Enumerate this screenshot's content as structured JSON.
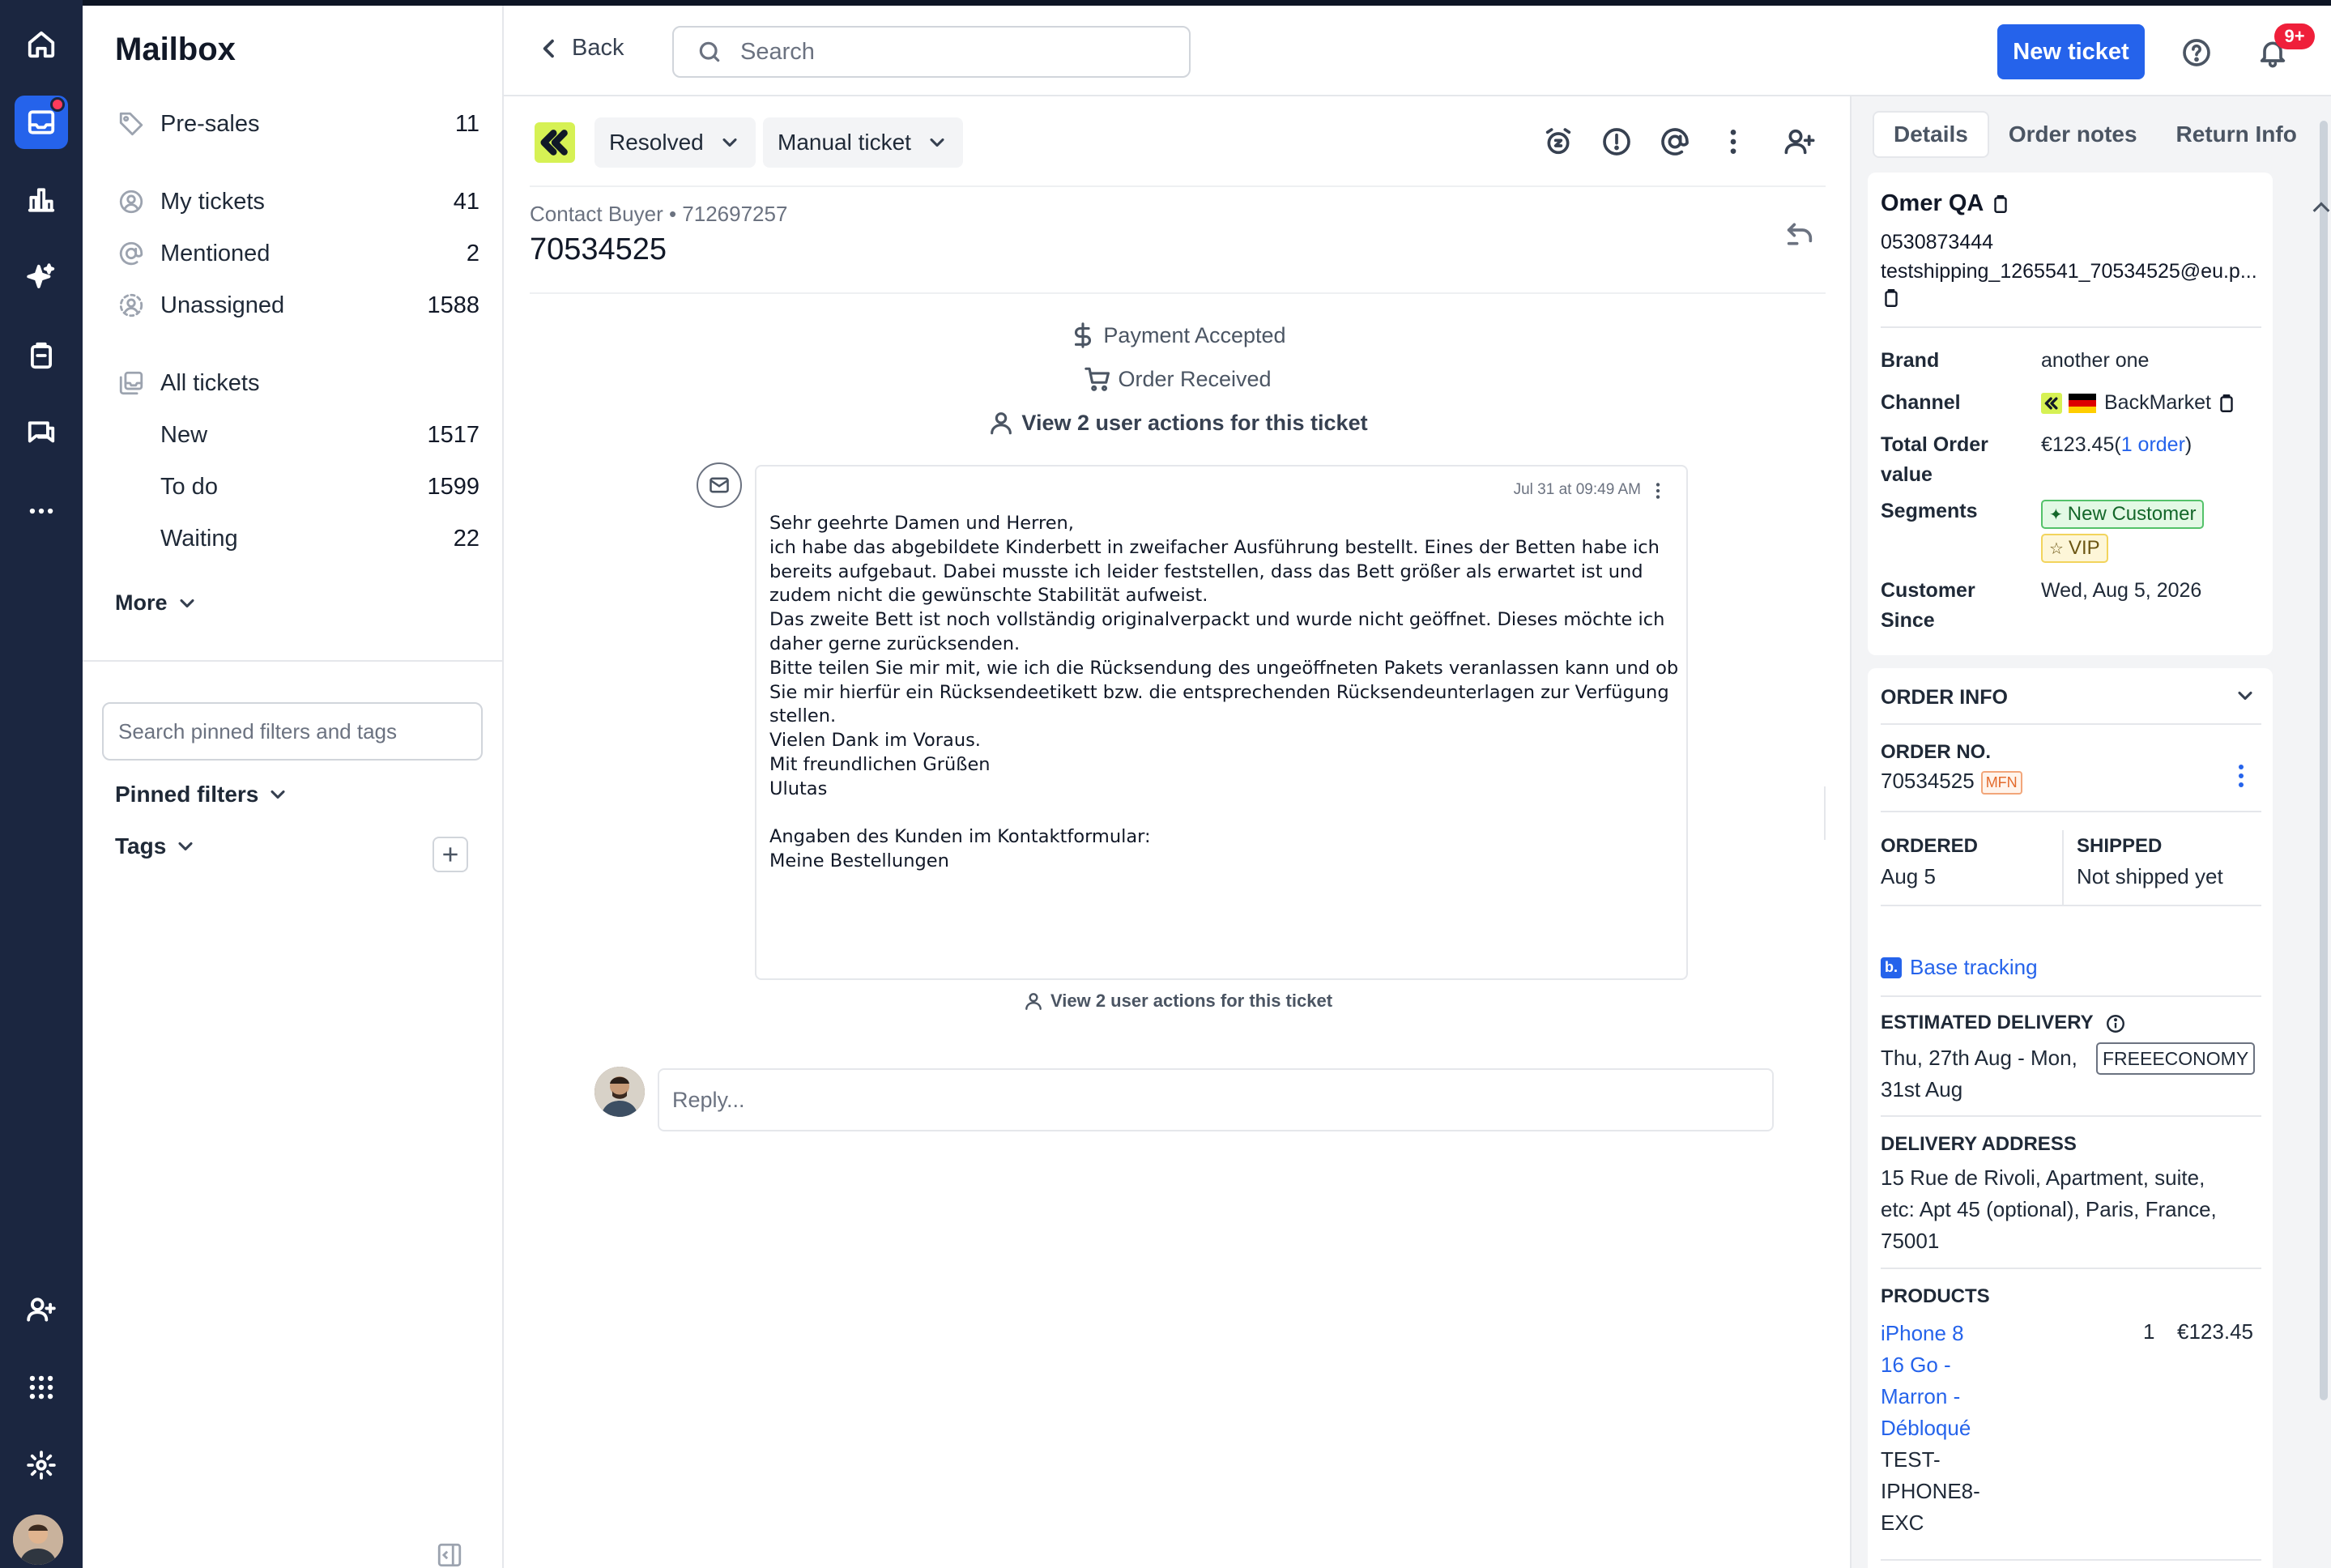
{
  "rail": {
    "icons": [
      "home-icon",
      "inbox-icon",
      "analytics-icon",
      "sparkle-icon",
      "clipboard-icon",
      "chat-icon",
      "more-dots-icon",
      "add-user-icon",
      "apps-grid-icon",
      "settings-gear-icon"
    ],
    "active": "inbox-icon",
    "accent_color": "#2563eb",
    "background": "#1b2640"
  },
  "mailbox": {
    "title": "Mailbox",
    "presales": {
      "label": "Pre-sales",
      "count": "11"
    },
    "views": [
      {
        "label": "My tickets",
        "count": "41"
      },
      {
        "label": "Mentioned",
        "count": "2"
      },
      {
        "label": "Unassigned",
        "count": "1588"
      }
    ],
    "all_tickets": {
      "label": "All tickets",
      "count": ""
    },
    "statuses": [
      {
        "label": "New",
        "count": "1517"
      },
      {
        "label": "To do",
        "count": "1599"
      },
      {
        "label": "Waiting",
        "count": "22"
      }
    ],
    "more_label": "More",
    "search_placeholder": "Search pinned filters and tags",
    "pinned_filters_label": "Pinned filters",
    "tags_label": "Tags"
  },
  "topbar": {
    "back_label": "Back",
    "search_placeholder": "Search",
    "new_ticket_label": "New ticket",
    "notification_badge": "9+"
  },
  "ticket": {
    "status": "Resolved",
    "type": "Manual ticket",
    "breadcrumb": "Contact Buyer • 712697257",
    "id": "70534525",
    "events": {
      "payment": "Payment Accepted",
      "order": "Order Received",
      "user_actions": "View 2 user actions for this ticket",
      "user_actions_bottom": "View 2 user actions for this ticket"
    },
    "message": {
      "timestamp": "Jul 31 at 09:49 AM",
      "lines": [
        "Sehr geehrte Damen und Herren,",
        "ich habe das abgebildete Kinderbett in zweifacher Ausführung bestellt. Eines der Betten habe ich",
        "bereits aufgebaut. Dabei musste ich leider feststellen, dass das Bett größer als erwartet ist und",
        "zudem nicht die gewünschte Stabilität aufweist.",
        "Das zweite Bett ist noch vollständig originalverpackt und wurde nicht geöffnet. Dieses möchte ich",
        "daher gerne zurücksenden.",
        "Bitte teilen Sie mir mit, wie ich die Rücksendung des ungeöffneten Pakets veranlassen kann und ob",
        "Sie mir hierfür ein Rücksendeetikett bzw. die entsprechenden Rücksendeunterlagen zur Verfügung",
        "stellen.",
        "Vielen Dank im Voraus.",
        "Mit freundlichen Grüßen",
        "Ulutas",
        "",
        "Angaben des Kunden im Kontaktformular:",
        "Meine Bestellungen"
      ]
    },
    "reply_placeholder": "Reply..."
  },
  "details": {
    "tabs": [
      "Details",
      "Order notes",
      "Return Info"
    ],
    "active_tab": "Details",
    "customer": {
      "name": "Omer QA",
      "phone": "0530873444",
      "email": "testshipping_1265541_70534525@eu.p...",
      "brand_label": "Brand",
      "brand": "another one",
      "channel_label": "Channel",
      "channel": "BackMarket",
      "total_label_1": "Total Order",
      "total_label_2": "value",
      "total_value": "€123.45",
      "total_orders_link": "1 order",
      "segments_label": "Segments",
      "segments": [
        "New Customer",
        "VIP"
      ],
      "since_label_1": "Customer",
      "since_label_2": "Since",
      "since_value": "Wed, Aug 5, 2026"
    },
    "order": {
      "section_title": "ORDER INFO",
      "order_no_label": "ORDER NO.",
      "order_no": "70534525",
      "order_badge": "MFN",
      "ordered_label": "ORDERED",
      "ordered_value": "Aug 5",
      "shipped_label": "SHIPPED",
      "shipped_value": "Not shipped yet",
      "tracking_badge": "b.",
      "tracking_label": "Base tracking",
      "est_delivery_label": "ESTIMATED DELIVERY",
      "est_delivery_line1": "Thu, 27th Aug - Mon,",
      "est_delivery_line2": "31st Aug",
      "shipping_method": "FREEECONOMY",
      "address_label": "DELIVERY ADDRESS",
      "address_lines": [
        "15 Rue de Rivoli, Apartment, suite,",
        "etc: Apt 45 (optional), Paris, France,",
        "75001"
      ],
      "products_label": "PRODUCTS",
      "product_name_lines": [
        "iPhone 8",
        "16 Go -",
        "Marron -",
        "Débloqué"
      ],
      "product_sku_lines": [
        "TEST-",
        "IPHONE8-",
        "EXC"
      ],
      "product_qty": "1",
      "product_price": "€123.45"
    }
  }
}
